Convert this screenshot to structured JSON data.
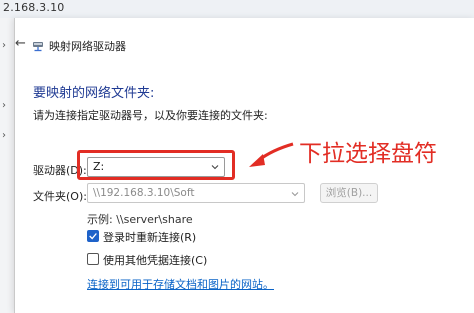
{
  "background": {
    "address_fragment": "2.168.3.10"
  },
  "dialog": {
    "title": "映射网络驱动器",
    "heading": "要映射的网络文件夹:",
    "instruction": "请为连接指定驱动器号，以及你要连接的文件夹:",
    "drive": {
      "label": "驱动器(D):",
      "value": "Z:"
    },
    "folder": {
      "label": "文件夹(O):",
      "value": "\\\\192.168.3.10\\Soft",
      "browse_label": "浏览(B)..."
    },
    "example": "示例: \\\\server\\share",
    "options": [
      {
        "label": "登录时重新连接(R)",
        "checked": true
      },
      {
        "label": "使用其他凭据连接(C)",
        "checked": false
      }
    ],
    "link": "连接到可用于存储文档和图片的网站。"
  },
  "annotation": {
    "text": "下拉选择盘符",
    "color": "#e22d24"
  }
}
